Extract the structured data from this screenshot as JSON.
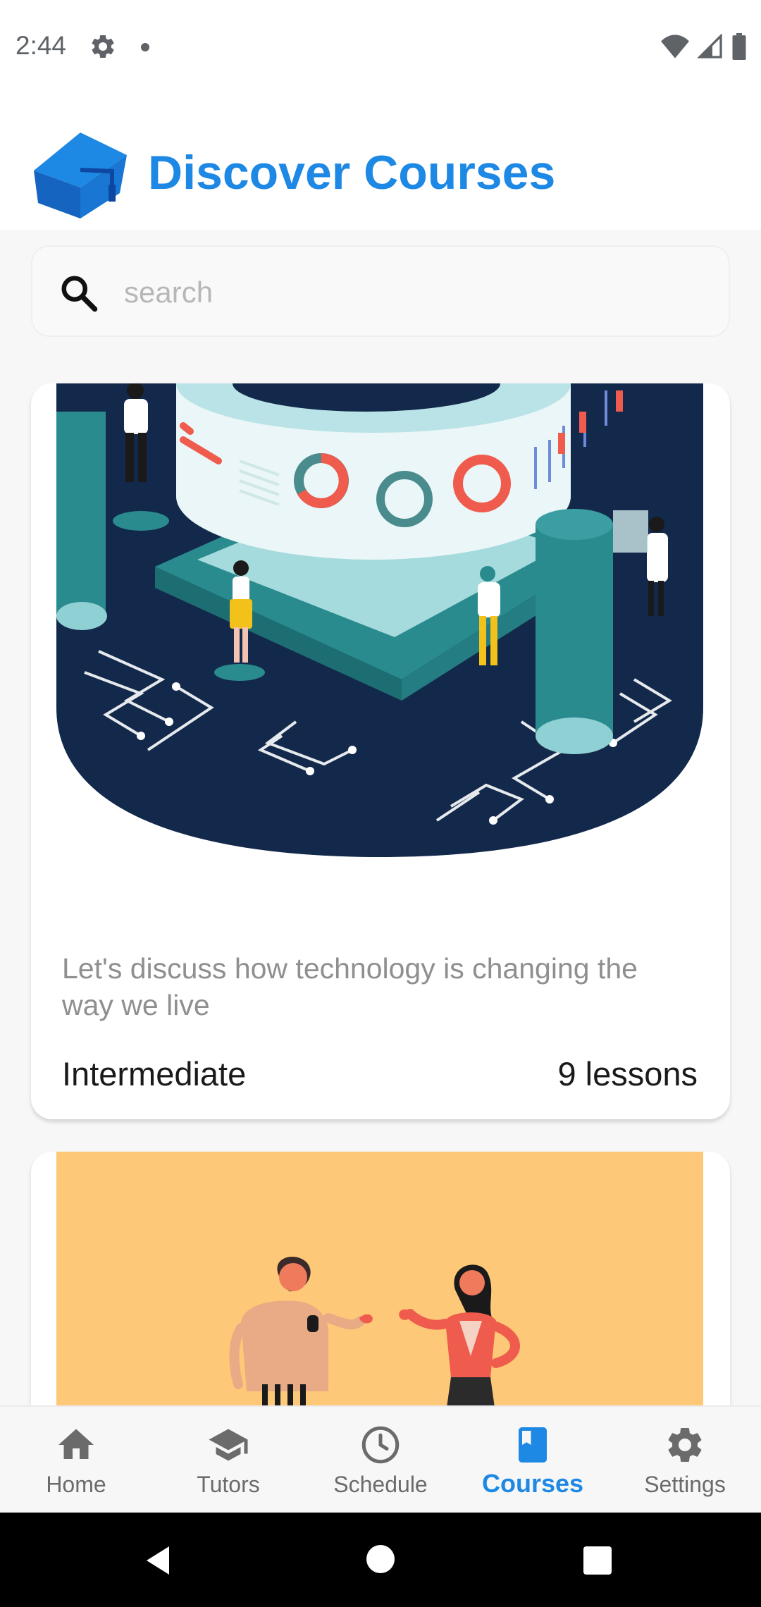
{
  "status_bar": {
    "time": "2:44",
    "icons": [
      "gear-icon",
      "notification-dot",
      "wifi-icon",
      "signal-icon",
      "battery-icon"
    ]
  },
  "header": {
    "title": "Discover Courses",
    "logo_icon": "graduation-cap-cube-icon",
    "title_color": "#1e88e5"
  },
  "search": {
    "placeholder": "search",
    "value": ""
  },
  "courses": [
    {
      "image": "technology-illustration",
      "description": "Let's discuss how technology is changing the way we live",
      "level": "Intermediate",
      "lessons": "9 lessons"
    },
    {
      "image": "conversation-illustration"
    }
  ],
  "bottom_nav": {
    "items": [
      {
        "label": "Home",
        "icon": "home-icon",
        "active": false
      },
      {
        "label": "Tutors",
        "icon": "school-icon",
        "active": false
      },
      {
        "label": "Schedule",
        "icon": "clock-icon",
        "active": false
      },
      {
        "label": "Courses",
        "icon": "book-icon",
        "active": true
      },
      {
        "label": "Settings",
        "icon": "gear-icon",
        "active": false
      }
    ],
    "active_color": "#1e88e5",
    "inactive_color": "#6b6b6b"
  },
  "colors": {
    "accent": "#1e88e5",
    "illustration_navy": "#13294b",
    "illustration_teal": "#2a8b8f",
    "illustration_orange": "#fdc877"
  }
}
